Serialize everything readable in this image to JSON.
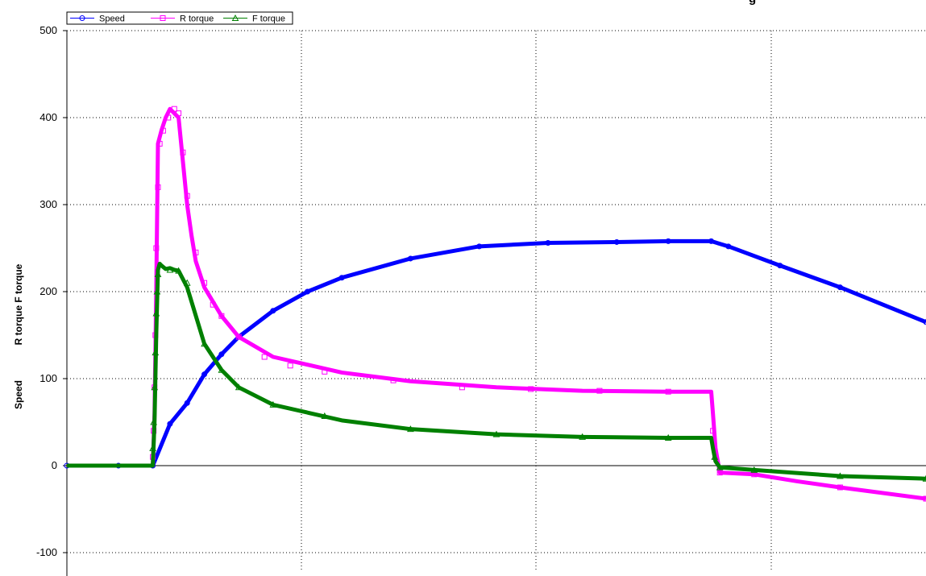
{
  "chart_data": {
    "type": "line",
    "title": "",
    "title_fragment": "g",
    "ylabel_lines": [
      "R torque F torque",
      "Speed"
    ],
    "xlabel": "",
    "ylim": [
      -100,
      500
    ],
    "xlim": [
      0,
      1000
    ],
    "yticks": [
      -100,
      0,
      100,
      200,
      300,
      400,
      500
    ],
    "grid": true,
    "legend_placement": "top-left",
    "series": [
      {
        "name": "Speed",
        "color": "#0000ff",
        "marker": "circle",
        "x": [
          0,
          60,
          100,
          120,
          140,
          160,
          180,
          200,
          240,
          280,
          320,
          400,
          480,
          560,
          640,
          700,
          750,
          770,
          830,
          900,
          1000
        ],
        "y": [
          0,
          0,
          0,
          48,
          72,
          105,
          128,
          148,
          178,
          200,
          216,
          238,
          252,
          256,
          257,
          258,
          258,
          252,
          230,
          205,
          165
        ]
      },
      {
        "name": "R torque",
        "color": "#ff00ff",
        "marker": "square",
        "x": [
          0,
          60,
          100,
          102,
          104,
          106,
          110,
          115,
          120,
          125,
          130,
          135,
          140,
          145,
          150,
          160,
          180,
          200,
          240,
          320,
          400,
          500,
          600,
          700,
          750,
          752,
          755,
          760,
          800,
          850,
          900,
          1000
        ],
        "y": [
          0,
          0,
          0,
          60,
          200,
          370,
          385,
          400,
          410,
          405,
          400,
          350,
          300,
          265,
          235,
          205,
          172,
          148,
          125,
          107,
          97,
          90,
          86,
          85,
          85,
          60,
          20,
          -8,
          -10,
          -18,
          -25,
          -38
        ],
        "marker_x": [
          100,
          101,
          102,
          103,
          104,
          106,
          108,
          112,
          118,
          125,
          130,
          135,
          140,
          150,
          160,
          170,
          180,
          200,
          230,
          260,
          300,
          380,
          460,
          540,
          620,
          700,
          752,
          755,
          760,
          800,
          900,
          1000
        ],
        "marker_y": [
          10,
          40,
          90,
          150,
          250,
          320,
          370,
          385,
          400,
          410,
          405,
          360,
          310,
          245,
          210,
          185,
          172,
          148,
          125,
          115,
          108,
          98,
          90,
          88,
          86,
          85,
          40,
          10,
          -8,
          -10,
          -25,
          -38
        ]
      },
      {
        "name": "F torque",
        "color": "#008000",
        "marker": "triangle",
        "x": [
          0,
          60,
          100,
          102,
          104,
          106,
          108,
          110,
          115,
          120,
          125,
          130,
          140,
          160,
          180,
          200,
          240,
          320,
          400,
          500,
          600,
          700,
          750,
          752,
          755,
          760,
          800,
          900,
          1000
        ],
        "y": [
          0,
          0,
          0,
          50,
          150,
          225,
          232,
          230,
          226,
          227,
          225,
          224,
          205,
          140,
          110,
          90,
          70,
          52,
          42,
          36,
          33,
          32,
          32,
          20,
          5,
          -2,
          -5,
          -12,
          -15
        ],
        "marker_x": [
          100,
          101,
          102,
          103,
          104,
          105,
          106,
          120,
          130,
          140,
          160,
          180,
          200,
          240,
          300,
          400,
          500,
          600,
          700,
          754,
          760,
          800,
          900,
          1000
        ],
        "marker_y": [
          20,
          50,
          90,
          130,
          175,
          200,
          220,
          225,
          224,
          210,
          140,
          110,
          90,
          70,
          57,
          42,
          36,
          33,
          32,
          10,
          -2,
          -5,
          -12,
          -15
        ]
      }
    ]
  }
}
